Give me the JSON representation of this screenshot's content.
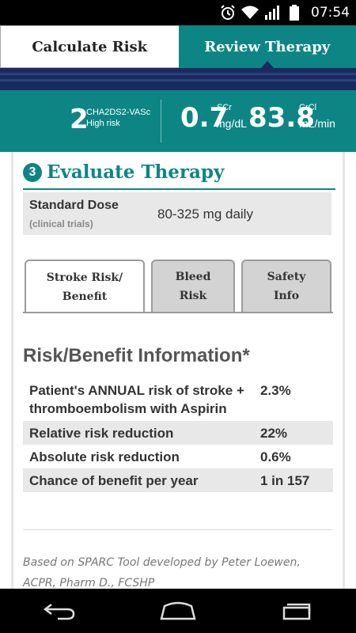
{
  "status_bar": {
    "time": "07:54",
    "icons": [
      "alarm-icon",
      "wifi-icon",
      "signal-icon",
      "battery-icon"
    ]
  },
  "top_tabs": {
    "left": "Calculate Risk",
    "right": "Review Therapy",
    "active": "right"
  },
  "stats": {
    "score_value": "2",
    "score_label": "CHA2DS2-VASc",
    "score_sub": "High risk",
    "scr_value": "0.7",
    "scr_label": "SCr",
    "scr_unit": "mg/dL",
    "crcl_value": "83.8",
    "crcl_label": "CrCl",
    "crcl_unit": "mL/min"
  },
  "section": {
    "number": "3",
    "title": "Evaluate Therapy"
  },
  "dose": {
    "label": "Standard Dose",
    "sub": "(clinical trials)",
    "value": "80-325 mg daily"
  },
  "inner_tabs": [
    {
      "line1": "Stroke Risk/",
      "line2": "Benefit",
      "active": true
    },
    {
      "line1": "Bleed",
      "line2": "Risk",
      "active": false
    },
    {
      "line1": "Safety",
      "line2": "Info",
      "active": false
    }
  ],
  "risk_benefit": {
    "heading": "Risk/Benefit Information*",
    "rows": [
      {
        "label": "Patient's ANNUAL risk of stroke + thromboembolism with Aspirin",
        "value": "2.3%"
      },
      {
        "label": "Relative risk reduction",
        "value": "22%"
      },
      {
        "label": "Absolute risk reduction",
        "value": "0.6%"
      },
      {
        "label": "Chance of benefit per year",
        "value": "1 in 157"
      }
    ]
  },
  "footnote": "Based on SPARC Tool developed by Peter Loewen, ACPR, Pharm D., FCSHP",
  "colors": {
    "teal": "#0e8585",
    "navy": "#1b2a5e",
    "gray": "#e8e8e8"
  }
}
